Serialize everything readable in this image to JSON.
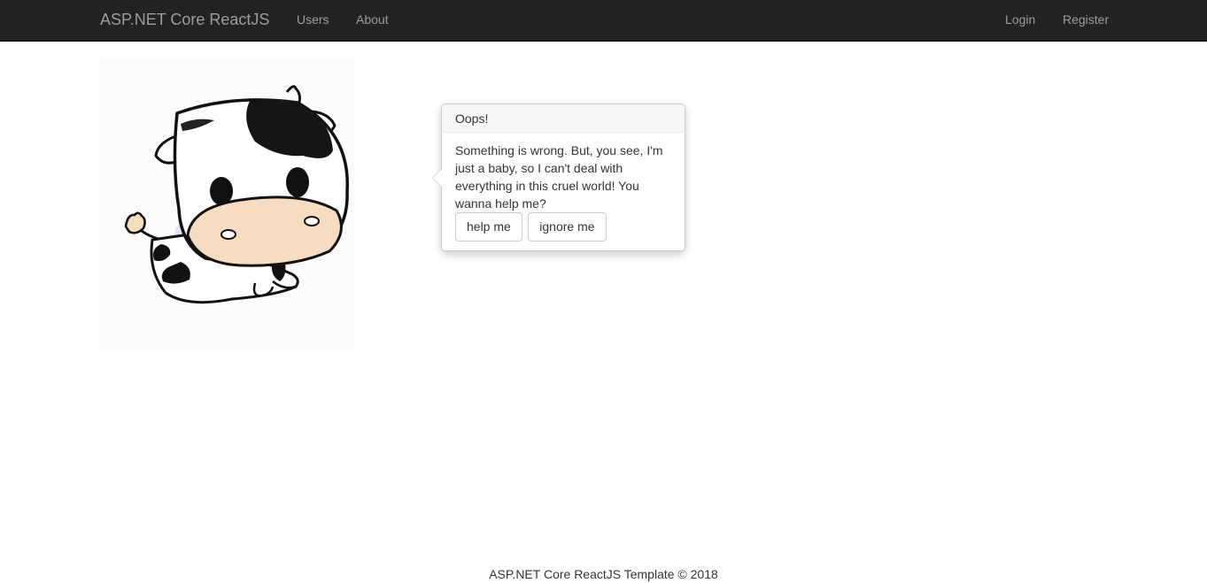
{
  "navbar": {
    "brand": "ASP.NET Core ReactJS",
    "left_links": [
      "Users",
      "About"
    ],
    "right_links": [
      "Login",
      "Register"
    ]
  },
  "popover": {
    "title": "Oops!",
    "message": "Something is wrong. But, you see, I'm just a baby, so I can't deal with everything in this cruel world! You wanna help me?",
    "buttons": [
      "help me",
      "ignore me"
    ]
  },
  "footer": {
    "text": "ASP.NET Core ReactJS Template © 2018"
  },
  "colors": {
    "navbar_bg": "#222222",
    "navbar_text": "#9d9d9d",
    "cow_muzzle": "#f7dcc0",
    "cow_shadow": "#d8d4ee"
  }
}
